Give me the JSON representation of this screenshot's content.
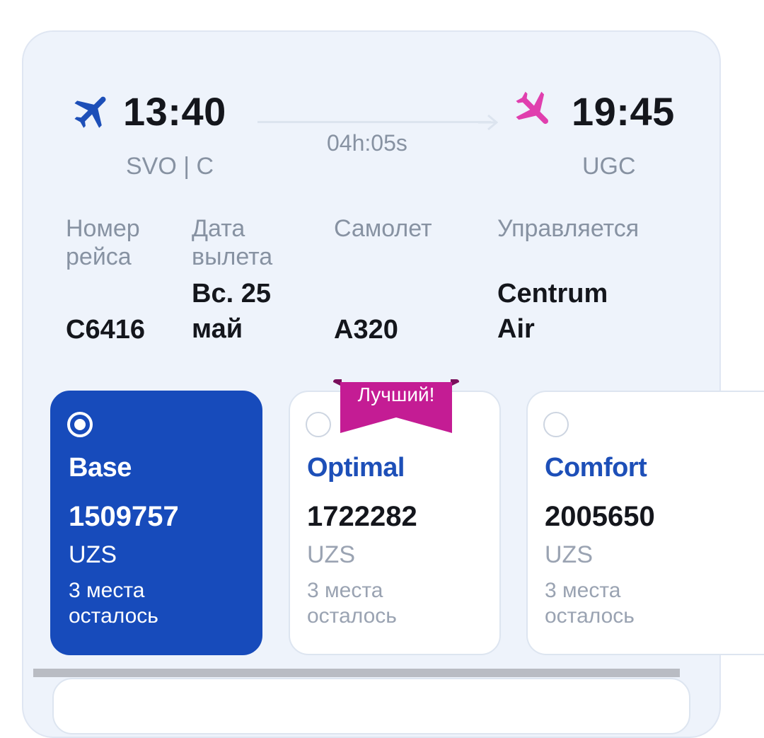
{
  "flight": {
    "departure_time": "13:40",
    "departure_code": "SVO | C",
    "arrival_time": "19:45",
    "arrival_code": "UGC",
    "duration": "04h:05s"
  },
  "details": {
    "flight_number_label": "Номер рейса",
    "flight_number_label_l1": "Номер",
    "flight_number_label_l2": "рейса",
    "flight_number": "C6416",
    "date_label_l1": "Дата",
    "date_label_l2": "вылета",
    "date_l1": "Вс. 25",
    "date_l2": "май",
    "aircraft_label": "Самолет",
    "aircraft": "A320",
    "operator_label": "Управляется",
    "operator_l1": "Centrum",
    "operator_l2": "Air"
  },
  "tariffs": [
    {
      "name": "Base",
      "price": "1509757",
      "currency": "UZS",
      "seats_l1": "3 места",
      "seats_l2": "осталось",
      "selected": true
    },
    {
      "name": "Optimal",
      "price": "1722282",
      "currency": "UZS",
      "seats_l1": "3 места",
      "seats_l2": "осталось",
      "selected": false,
      "badge": "Лучший!"
    },
    {
      "name": "Comfort",
      "price": "2005650",
      "currency": "UZS",
      "seats_l1": "3 места",
      "seats_l2": "осталось",
      "selected": false
    }
  ],
  "colors": {
    "accent": "#174bbb",
    "badge": "#c41c94",
    "departure_icon": "#1d4fb8",
    "arrival_icon": "#e03fae",
    "card_bg": "#eef3fb"
  },
  "icons": {
    "departure": "plane-takeoff-icon",
    "arrival": "plane-landing-icon",
    "route": "arrow-right-icon"
  }
}
